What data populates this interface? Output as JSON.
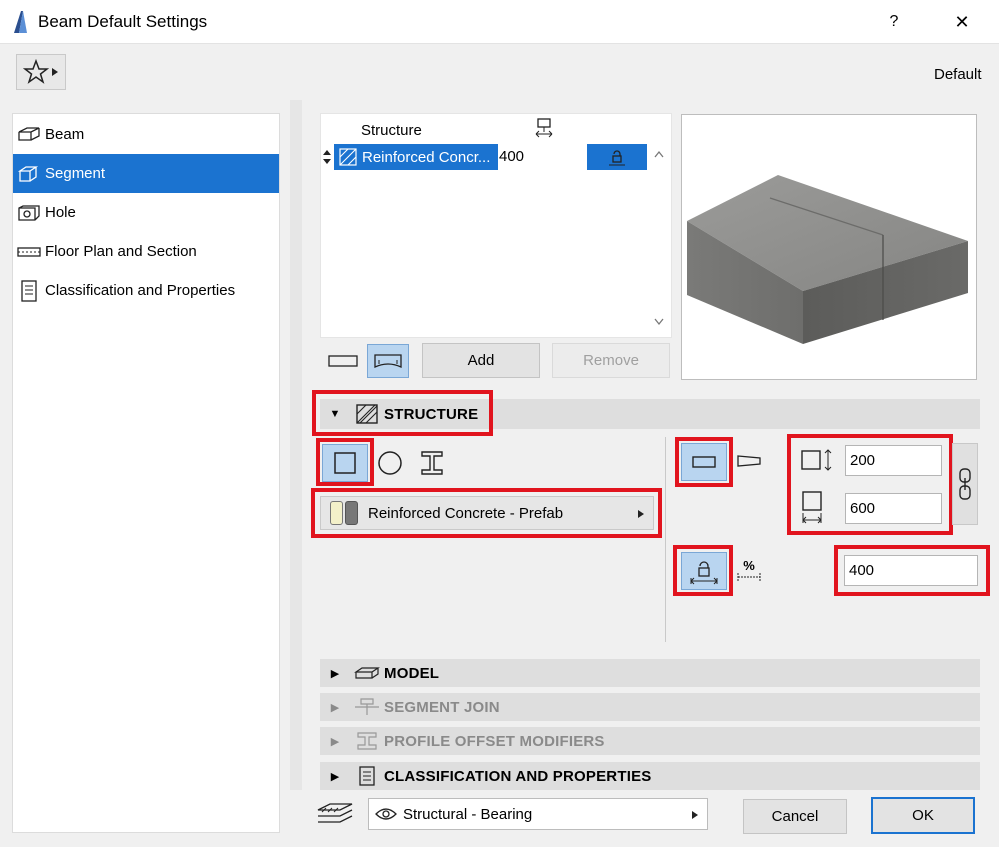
{
  "window": {
    "title": "Beam Default Settings",
    "help_label": "?",
    "close_label": "✕"
  },
  "favorites": {
    "label": "Default"
  },
  "sidebar": {
    "items": [
      {
        "label": "Beam",
        "icon": "beam-icon",
        "active": false
      },
      {
        "label": "Segment",
        "icon": "segment-icon",
        "active": true
      },
      {
        "label": "Hole",
        "icon": "hole-icon",
        "active": false
      },
      {
        "label": "Floor Plan and Section",
        "icon": "floor-plan-icon",
        "active": false
      },
      {
        "label": "Classification and Properties",
        "icon": "classification-icon",
        "active": false
      }
    ]
  },
  "segment_list": {
    "header_label": "Structure",
    "row": {
      "name": "Reinforced Concr...",
      "value": "400"
    }
  },
  "buttons": {
    "add": "Add",
    "remove": "Remove"
  },
  "sections": {
    "structure": "STRUCTURE",
    "model": "MODEL",
    "segment_join": "SEGMENT JOIN",
    "profile_offset": "PROFILE OFFSET MODIFIERS",
    "classification": "CLASSIFICATION AND PROPERTIES"
  },
  "structure": {
    "material_label": "Reinforced Concrete - Prefab",
    "width": "200",
    "height": "600",
    "taper": "400",
    "percent_symbol": "%"
  },
  "bottom": {
    "layer_label": "Structural - Bearing",
    "cancel": "Cancel",
    "ok": "OK"
  },
  "colors": {
    "selection": "#1b73d0",
    "highlight": "#e1141e",
    "toggle_on": "#b9d5f0"
  }
}
